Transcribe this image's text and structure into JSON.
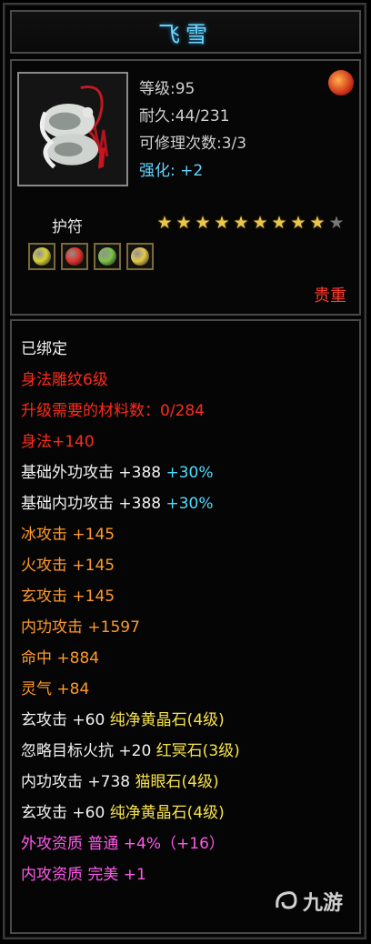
{
  "title": "飞雪",
  "item": {
    "icon": "jade-pendant-icon",
    "level": "等级:95",
    "durability": "耐久:44/231",
    "repairs": "可修理次数:3/3",
    "enhance_label": "强化:",
    "enhance_value": "+2"
  },
  "type_label": "护符",
  "stars": {
    "filled": 9,
    "total": 10
  },
  "gems": [
    {
      "name": "yellow-gem-icon",
      "color": "#d8d23a"
    },
    {
      "name": "red-gem-icon",
      "color": "#e0352a"
    },
    {
      "name": "green-gem-icon",
      "color": "#7fc24a"
    },
    {
      "name": "yellow-gem-icon",
      "color": "#e6c94a"
    }
  ],
  "quality": "贵重",
  "lines": [
    {
      "text": "已绑定",
      "color": "white"
    },
    {
      "text": "身法雕纹6级",
      "color": "red"
    },
    {
      "text": "升级需要的材料数：0/284",
      "color": "red"
    },
    {
      "text": "身法+140",
      "color": "red"
    },
    {
      "text": "基础外功攻击 +388 ",
      "color": "white",
      "extra": "+30%",
      "extra_color": "cyan"
    },
    {
      "text": "基础内功攻击 +388 ",
      "color": "white",
      "extra": "+30%",
      "extra_color": "cyan"
    },
    {
      "text": "冰攻击 +145",
      "color": "orange"
    },
    {
      "text": "火攻击 +145",
      "color": "orange"
    },
    {
      "text": "玄攻击 +145",
      "color": "orange"
    },
    {
      "text": "内功攻击 +1597",
      "color": "orange"
    },
    {
      "text": "命中 +884",
      "color": "orange"
    },
    {
      "text": "灵气 +84",
      "color": "orange"
    },
    {
      "text": "玄攻击 +60 ",
      "color": "white",
      "extra": "纯净黄晶石(4级)",
      "extra_color": "yellow"
    },
    {
      "text": "忽略目标火抗 +20 ",
      "color": "white",
      "extra": "红冥石(3级)",
      "extra_color": "yellow"
    },
    {
      "text": "内功攻击 +738 ",
      "color": "white",
      "extra": "猫眼石(4级)",
      "extra_color": "yellow"
    },
    {
      "text": "玄攻击 +60 ",
      "color": "white",
      "extra": "纯净黄晶石(4级)",
      "extra_color": "yellow"
    },
    {
      "text": "外攻资质  普通 +4%（+16）",
      "color": "magenta"
    },
    {
      "text": "内攻资质  完美 +1",
      "color": "magenta"
    }
  ],
  "watermark": "九游",
  "colors": {
    "white": "#f2f2f2",
    "red": "#ff2a1a",
    "orange": "#ff9a2a",
    "yellow": "#f7e24a",
    "magenta": "#ff5ae8",
    "cyan": "#4fdcff"
  }
}
